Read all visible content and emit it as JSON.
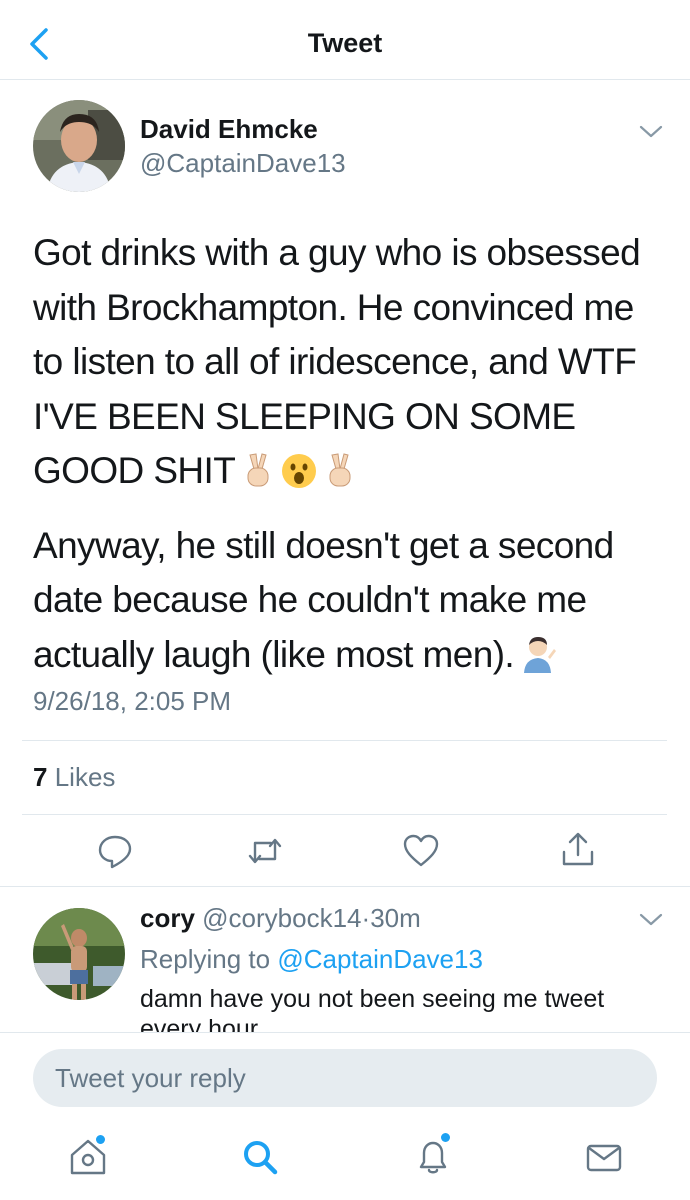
{
  "nav": {
    "title": "Tweet"
  },
  "tweet": {
    "author_name": "David Ehmcke",
    "author_handle": "@CaptainDave13",
    "paragraph1": "Got drinks with a guy who is obsessed with Brockhampton. He convinced me to listen to all of iridescence, and WTF I'VE BEEN SLEEPING ON SOME GOOD SHIT",
    "paragraph2": "Anyway, he still doesn't get a second date because he couldn't make me actually laugh (like most men).",
    "timestamp": "9/26/18, 2:05 PM",
    "likes_count": "7",
    "likes_label": "Likes"
  },
  "reply": {
    "author_name": "cory",
    "author_handle": "@corybock14",
    "separator": "·",
    "time": "30m",
    "replying_prefix": "Replying to",
    "replying_handle": "@CaptainDave13",
    "text": "damn have you not been seeing me tweet every hour"
  },
  "composer": {
    "placeholder": "Tweet your reply"
  },
  "icons": {
    "back": "chevron-left-icon",
    "caret": "chevron-down-icon",
    "actions": [
      "reply-icon",
      "retweet-icon",
      "like-icon",
      "share-icon"
    ],
    "tabs": [
      "home-icon",
      "search-icon",
      "notifications-icon",
      "messages-icon"
    ]
  },
  "colors": {
    "accent": "#1da1f2",
    "secondary_text": "#657786",
    "divider": "#e1e8ed"
  }
}
